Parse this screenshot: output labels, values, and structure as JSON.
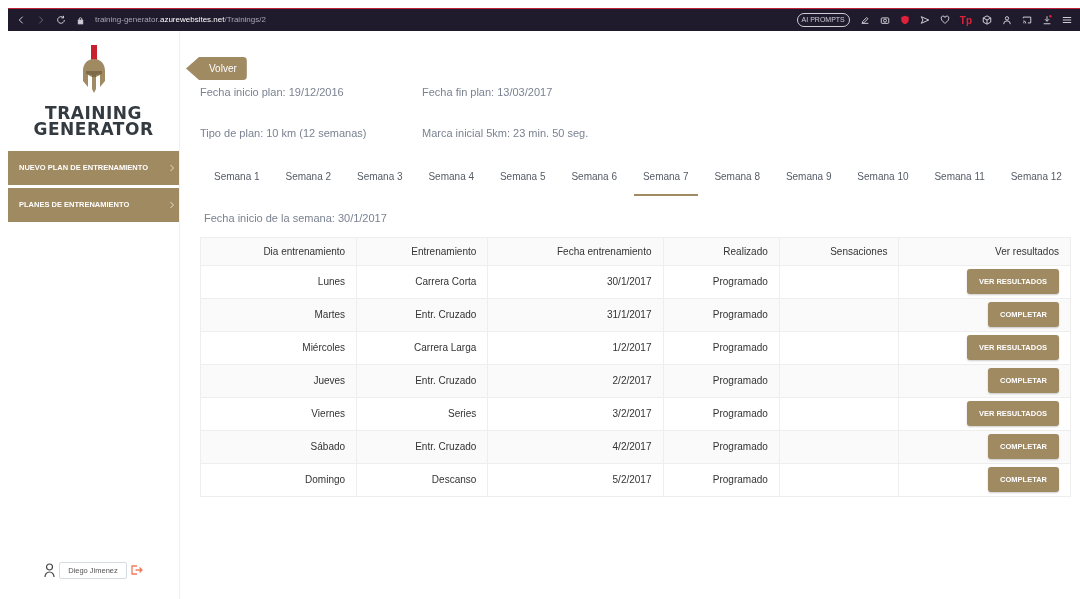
{
  "browser": {
    "url": "training-generator.**azurewebsites.net**/Trainings/2",
    "ai_button": "AI PROMPTS",
    "ext_logo": "Tp"
  },
  "sidebar": {
    "logo_line1": "TRAINING",
    "logo_line2": "GENERATOR",
    "items": [
      {
        "label": "NUEVO PLAN DE ENTRENAMIENTO"
      },
      {
        "label": "PLANES DE ENTRENAMIENTO"
      }
    ],
    "user": {
      "name": "Diego Jimenez"
    }
  },
  "back_button": "Volver",
  "plan": {
    "start": "Fecha inicio plan: 19/12/2016",
    "end": "Fecha fin plan: 13/03/2017",
    "type": "Tipo de plan: 10 km (12 semanas)",
    "mark": "Marca inicial 5km: 23 min. 50 seg."
  },
  "tabs": [
    {
      "label": "Semana 1",
      "selected": false
    },
    {
      "label": "Semana 2",
      "selected": false
    },
    {
      "label": "Semana 3",
      "selected": false
    },
    {
      "label": "Semana 4",
      "selected": false
    },
    {
      "label": "Semana 5",
      "selected": false
    },
    {
      "label": "Semana 6",
      "selected": false
    },
    {
      "label": "Semana 7",
      "selected": true
    },
    {
      "label": "Semana 8",
      "selected": false
    },
    {
      "label": "Semana 9",
      "selected": false
    },
    {
      "label": "Semana 10",
      "selected": false
    },
    {
      "label": "Semana 11",
      "selected": false
    },
    {
      "label": "Semana 12",
      "selected": false
    }
  ],
  "week_start": "Fecha inicio de la semana: 30/1/2017",
  "table": {
    "columns": [
      "Dia entrenamiento",
      "Entrenamiento",
      "Fecha entrenamiento",
      "Realizado",
      "Sensaciones",
      "Ver resultados"
    ],
    "rows": [
      {
        "day": "Lunes",
        "training": "Carrera Corta",
        "date": "30/1/2017",
        "done": "Programado",
        "action": "VER RESULTADOS"
      },
      {
        "day": "Martes",
        "training": "Entr. Cruzado",
        "date": "31/1/2017",
        "done": "Programado",
        "action": "COMPLETAR"
      },
      {
        "day": "Miércoles",
        "training": "Carrera Larga",
        "date": "1/2/2017",
        "done": "Programado",
        "action": "VER RESULTADOS"
      },
      {
        "day": "Jueves",
        "training": "Entr. Cruzado",
        "date": "2/2/2017",
        "done": "Programado",
        "action": "COMPLETAR"
      },
      {
        "day": "Viernes",
        "training": "Series",
        "date": "3/2/2017",
        "done": "Programado",
        "action": "VER RESULTADOS"
      },
      {
        "day": "Sábado",
        "training": "Entr. Cruzado",
        "date": "4/2/2017",
        "done": "Programado",
        "action": "COMPLETAR"
      },
      {
        "day": "Domingo",
        "training": "Descanso",
        "date": "5/2/2017",
        "done": "Programado",
        "action": "COMPLETAR"
      }
    ]
  }
}
